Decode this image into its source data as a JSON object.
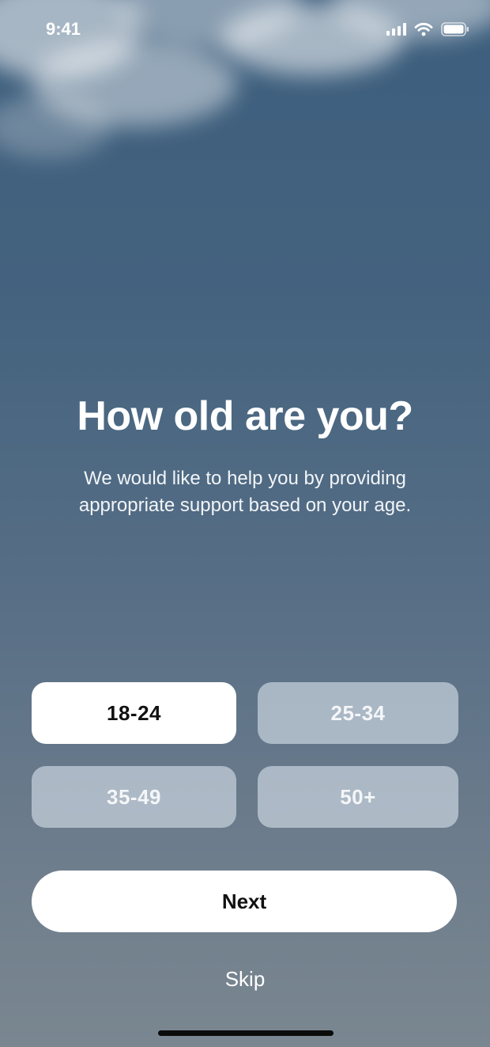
{
  "status_bar": {
    "time": "9:41"
  },
  "question": {
    "title": "How old are you?",
    "description": "We would like to help you by providing appropriate support based on your age."
  },
  "age_options": [
    {
      "label": "18-24",
      "selected": true
    },
    {
      "label": "25-34",
      "selected": false
    },
    {
      "label": "35-49",
      "selected": false
    },
    {
      "label": "50+",
      "selected": false
    }
  ],
  "actions": {
    "next_label": "Next",
    "skip_label": "Skip"
  },
  "colors": {
    "background_top": "#3c5e7d",
    "background_bottom": "#7a8791",
    "selected_option_bg": "#ffffff",
    "unselected_option_bg": "#b3c0cc"
  }
}
